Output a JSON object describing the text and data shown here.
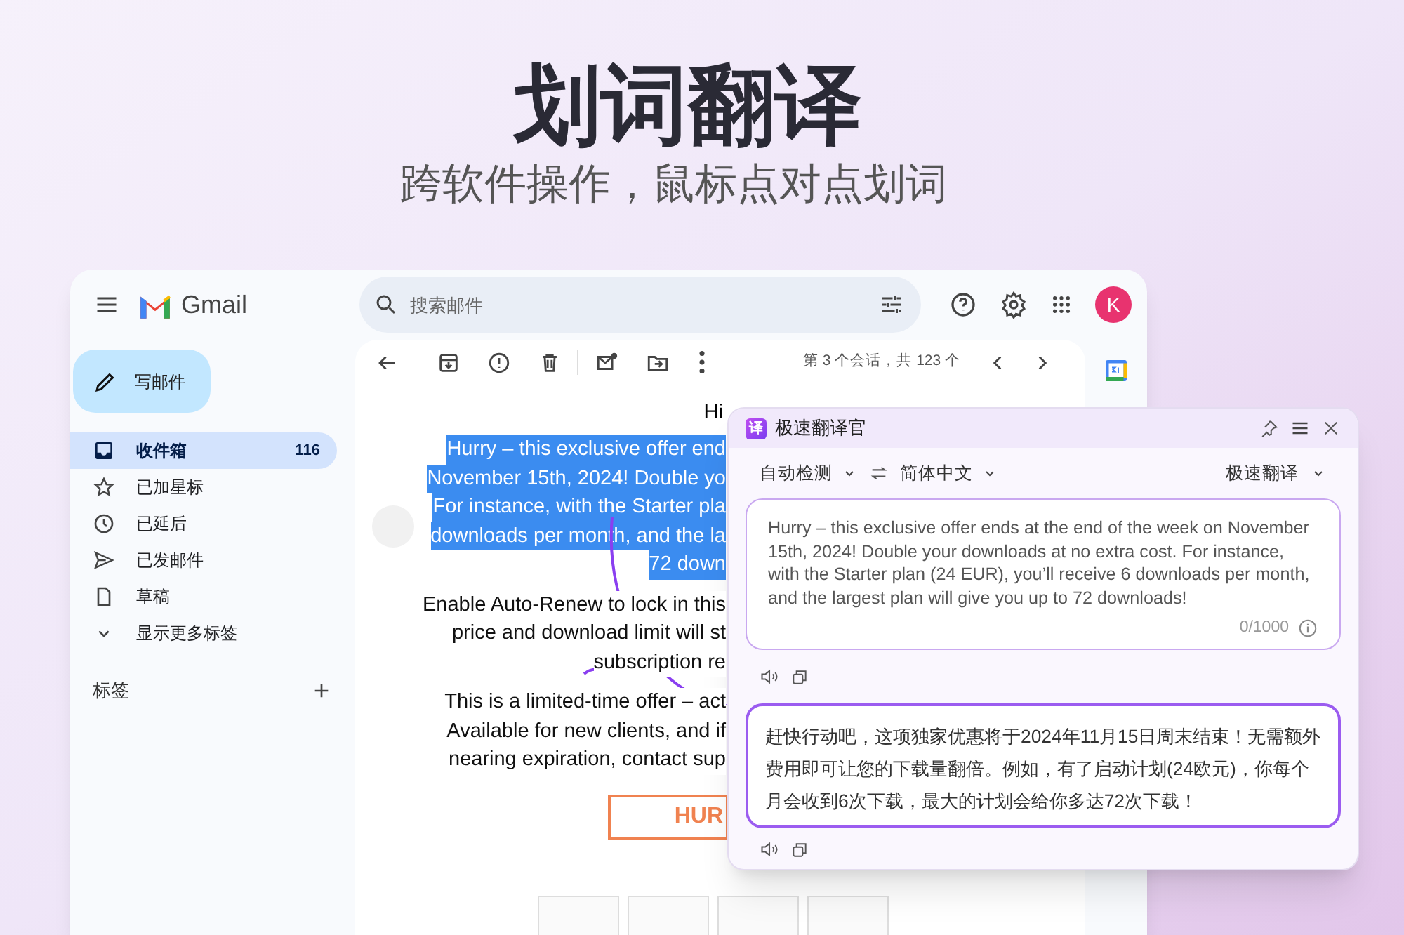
{
  "hero": {
    "title": "划词翻译",
    "subtitle": "跨软件操作，鼠标点对点划词"
  },
  "gmail": {
    "app_name": "Gmail",
    "compose": "写邮件",
    "search": {
      "placeholder": "搜索邮件"
    },
    "avatar": "K",
    "sidebar": [
      {
        "label": "收件箱",
        "count": "116",
        "selected": true
      },
      {
        "label": "已加星标",
        "selected": false
      },
      {
        "label": "已延后",
        "selected": false
      },
      {
        "label": "已发邮件",
        "selected": false
      },
      {
        "label": "草稿",
        "selected": false
      },
      {
        "label": "显示更多标签",
        "selected": false
      }
    ],
    "labels_heading": "标签",
    "pager": "第 3 个会话，共 123 个",
    "email": {
      "greeting": "Hi",
      "paragraphs": [
        {
          "selected": true,
          "lines": [
            "Hurry – this exclusive offer end",
            "November 15th, 2024! Double yo",
            "For instance, with the Starter pla",
            "downloads per month, and the la",
            "72 down"
          ]
        },
        {
          "selected": false,
          "lines": [
            "Enable Auto-Renew to lock in this",
            "price and download limit will st",
            "subscription re"
          ]
        },
        {
          "selected": false,
          "lines": [
            "This is a limited-time offer – act",
            "Available for new clients, and if",
            "nearing expiration, contact sup"
          ]
        }
      ],
      "button": "HUR"
    }
  },
  "translator": {
    "logo": "译",
    "title": "极速翻译官",
    "source_lang": "自动检测",
    "target_lang": "简体中文",
    "engine": "极速翻译",
    "source_text": "Hurry – this exclusive offer ends at the end of the week on November 15th, 2024! Double your downloads at no extra cost. For instance, with the Starter plan (24 EUR), you’ll receive 6 downloads per month, and the largest plan will give you up to 72 downloads!",
    "counter": "0/1000",
    "result_text": "赶快行动吧，这项独家优惠将于2024年11月15日周末结束！无需额外费用即可让您的下载量翻倍。例如，有了启动计划(24欧元)，你每个月会收到6次下载，最大的计划会给你多达72次下载！"
  }
}
